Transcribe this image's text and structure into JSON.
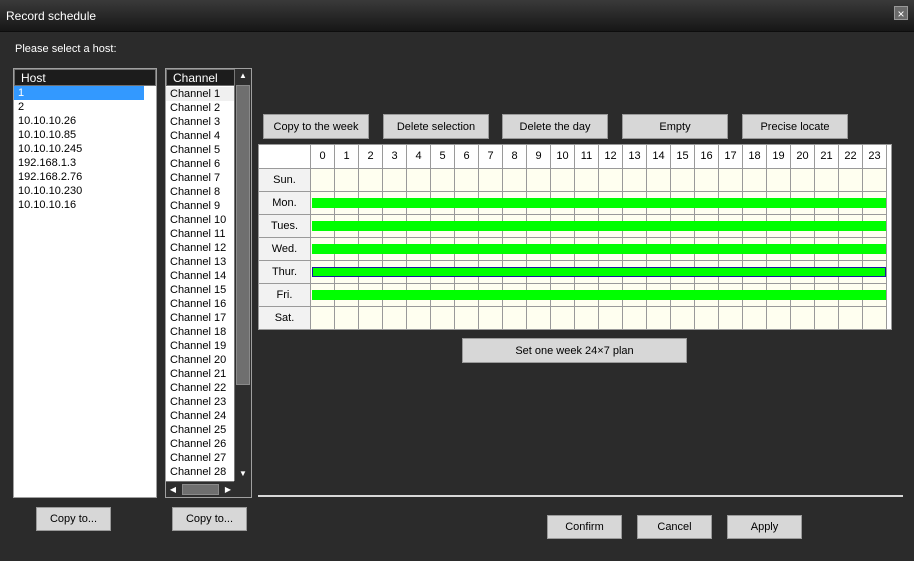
{
  "window": {
    "title": "Record schedule",
    "close_label": "×"
  },
  "prompt": "Please select a host:",
  "host_list": {
    "header": "Host",
    "items": [
      "1",
      "2",
      "10.10.10.26",
      "10.10.10.85",
      "10.10.10.245",
      "192.168.1.3",
      "192.168.2.76",
      "10.10.10.230",
      "10.10.10.16"
    ],
    "selected_index": 0
  },
  "channel_list": {
    "header": "Channel",
    "items": [
      "Channel 1",
      "Channel 2",
      "Channel 3",
      "Channel 4",
      "Channel 5",
      "Channel 6",
      "Channel 7",
      "Channel 8",
      "Channel 9",
      "Channel 10",
      "Channel 11",
      "Channel 12",
      "Channel 13",
      "Channel 14",
      "Channel 15",
      "Channel 16",
      "Channel 17",
      "Channel 18",
      "Channel 19",
      "Channel 20",
      "Channel 21",
      "Channel 22",
      "Channel 23",
      "Channel 24",
      "Channel 25",
      "Channel 26",
      "Channel 27",
      "Channel 28"
    ]
  },
  "toolbar": {
    "copy_week": "Copy to the week",
    "delete_selection": "Delete selection",
    "delete_day": "Delete the day",
    "empty": "Empty",
    "precise_locate": "Precise locate"
  },
  "schedule": {
    "hours": [
      "0",
      "1",
      "2",
      "3",
      "4",
      "5",
      "6",
      "7",
      "8",
      "9",
      "10",
      "11",
      "12",
      "13",
      "14",
      "15",
      "16",
      "17",
      "18",
      "19",
      "20",
      "21",
      "22",
      "23"
    ],
    "days": [
      {
        "label": "Sun.",
        "recorded": false
      },
      {
        "label": "Mon.",
        "recorded": true
      },
      {
        "label": "Tues.",
        "recorded": true
      },
      {
        "label": "Wed.",
        "recorded": true
      },
      {
        "label": "Thur.",
        "recorded": true,
        "selected": true
      },
      {
        "label": "Fri.",
        "recorded": true
      },
      {
        "label": "Sat.",
        "recorded": false
      }
    ],
    "colors": {
      "record": "#00ff00",
      "cell": "#fffff0",
      "selection": "#1a1aa0"
    }
  },
  "week_plan_button": "Set one week 24×7 plan",
  "copy_host_button": "Copy to...",
  "copy_channel_button": "Copy to...",
  "footer": {
    "confirm": "Confirm",
    "cancel": "Cancel",
    "apply": "Apply"
  },
  "icons": {
    "close": "close-icon",
    "scroll_up": "scroll-up-icon",
    "scroll_down": "scroll-down-icon",
    "scroll_left": "scroll-left-icon",
    "scroll_right": "scroll-right-icon"
  }
}
